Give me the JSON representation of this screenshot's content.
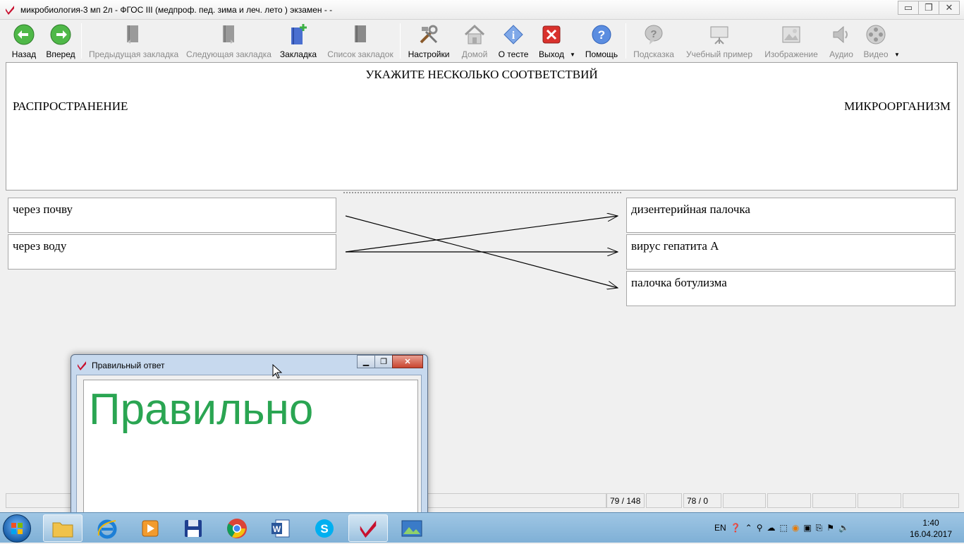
{
  "window": {
    "title": "микробиология-3 мп 2л - ФГОС III (медпроф. пед. зима и леч. лето ) экзамен -  -"
  },
  "toolbar": {
    "back": "Назад",
    "forward": "Вперед",
    "prev_bookmark": "Предыдущая закладка",
    "next_bookmark": "Следующая закладка",
    "bookmark": "Закладка",
    "bookmark_list": "Список закладок",
    "settings": "Настройки",
    "home": "Домой",
    "about": "О тесте",
    "exit": "Выход",
    "help": "Помощь",
    "hint": "Подсказка",
    "example": "Учебный пример",
    "image": "Изображение",
    "audio": "Аудио",
    "video": "Видео"
  },
  "question": {
    "instruction": "УКАЖИТЕ НЕСКОЛЬКО СООТВЕТСТВИЙ",
    "left_header": "РАСПРОСТРАНЕНИЕ",
    "right_header": "МИКРООРГАНИЗМ",
    "left_items": [
      "через почву",
      "через воду"
    ],
    "right_items": [
      "дизентерийная палочка",
      "вирус гепатита А",
      "палочка ботулизма"
    ],
    "connections": [
      [
        0,
        2
      ],
      [
        1,
        0
      ],
      [
        1,
        1
      ]
    ]
  },
  "status": {
    "progress": "79 / 148",
    "score": "78 / 0"
  },
  "dialog": {
    "title": "Правильный ответ",
    "verdict": "Правильно",
    "verdict_color": "#2aa552"
  },
  "taskbar": {
    "lang": "EN",
    "time": "1:40",
    "date": "16.04.2017"
  }
}
